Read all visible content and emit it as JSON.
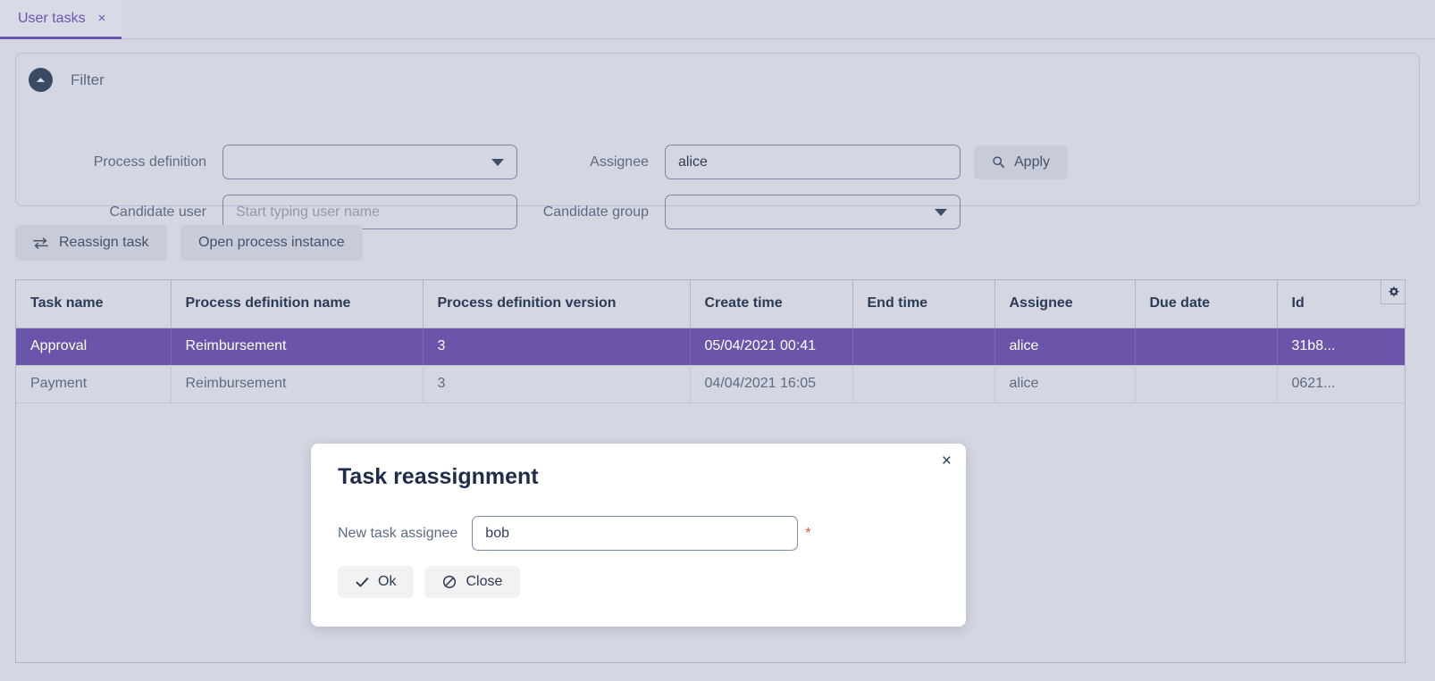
{
  "tab": {
    "label": "User tasks",
    "close_icon": "close-icon",
    "close_glyph": "×"
  },
  "filter": {
    "title": "Filter",
    "collapse_icon": "chevron-up-circle-icon",
    "process_definition": {
      "label": "Process definition",
      "value": "",
      "placeholder": ""
    },
    "assignee": {
      "label": "Assignee",
      "value": "alice",
      "placeholder": ""
    },
    "candidate_user": {
      "label": "Candidate user",
      "value": "",
      "placeholder": "Start typing user name"
    },
    "candidate_group": {
      "label": "Candidate group",
      "value": "",
      "placeholder": ""
    },
    "apply_button": {
      "label": "Apply",
      "icon": "search-icon"
    }
  },
  "actions": {
    "reassign": {
      "label": "Reassign task",
      "icon": "swap-arrows-icon"
    },
    "open_instance": {
      "label": "Open process instance"
    }
  },
  "table": {
    "settings_icon": "gear-icon",
    "columns": [
      "Task name",
      "Process definition name",
      "Process definition version",
      "Create time",
      "End time",
      "Assignee",
      "Due date",
      "Id"
    ],
    "rows": [
      {
        "selected": true,
        "cells": [
          "Approval",
          "Reimbursement",
          "3",
          "05/04/2021 00:41",
          "",
          "alice",
          "",
          "31b8..."
        ]
      },
      {
        "selected": false,
        "cells": [
          "Payment",
          "Reimbursement",
          "3",
          "04/04/2021 16:05",
          "",
          "alice",
          "",
          "0621..."
        ]
      }
    ]
  },
  "modal": {
    "title": "Task reassignment",
    "close_icon": "close-icon",
    "close_glyph": "×",
    "field_label": "New task assignee",
    "field_value": "bob",
    "field_placeholder": "",
    "required_marker": "*",
    "ok_button": {
      "label": "Ok",
      "icon": "check-icon"
    },
    "close_button": {
      "label": "Close",
      "icon": "ban-icon"
    }
  },
  "colors": {
    "page_background": "#d4d7e2",
    "accent_purple": "#6a56b0",
    "selected_row": "#6a55ab",
    "text_dark": "#2c3a54",
    "text_muted": "#5b6b84",
    "required_red": "#e0564b",
    "border": "#b0b5cc"
  }
}
